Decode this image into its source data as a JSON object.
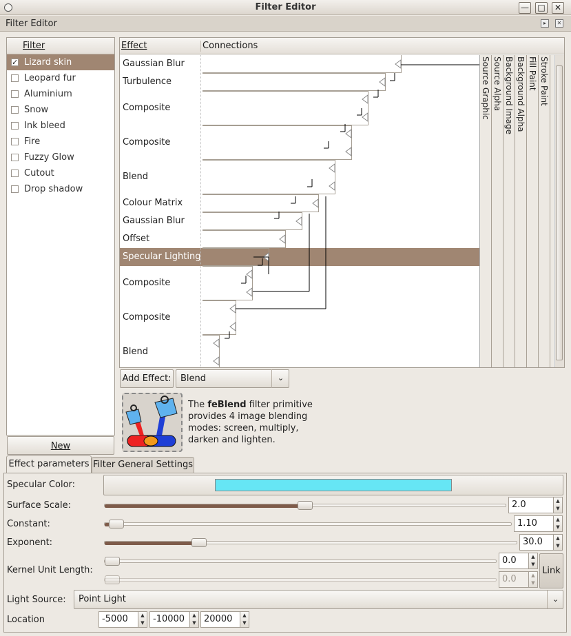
{
  "window": {
    "title": "Filter Editor"
  },
  "dock": {
    "title": "Filter Editor"
  },
  "filters": {
    "header": "Filter",
    "items": [
      {
        "label": "Lizard skin",
        "checked": true
      },
      {
        "label": "Leopard fur",
        "checked": false
      },
      {
        "label": "Aluminium",
        "checked": false
      },
      {
        "label": "Snow",
        "checked": false
      },
      {
        "label": "Ink bleed",
        "checked": false
      },
      {
        "label": "Fire",
        "checked": false
      },
      {
        "label": "Fuzzy Glow",
        "checked": false
      },
      {
        "label": "Cutout",
        "checked": false
      },
      {
        "label": "Drop shadow",
        "checked": false
      }
    ],
    "new_label": "New"
  },
  "effects": {
    "header_effect": "Effect",
    "header_connections": "Connections",
    "items": [
      {
        "label": "Gaussian Blur"
      },
      {
        "label": "Turbulence"
      },
      {
        "label": "Composite"
      },
      {
        "label": "Composite"
      },
      {
        "label": "Blend"
      },
      {
        "label": "Colour Matrix"
      },
      {
        "label": "Gaussian Blur"
      },
      {
        "label": "Offset"
      },
      {
        "label": "Specular Lighting",
        "selected": true
      },
      {
        "label": "Composite"
      },
      {
        "label": "Composite"
      },
      {
        "label": "Blend"
      }
    ],
    "sources": [
      "Source Graphic",
      "Source Alpha",
      "Background Image",
      "Background Alpha",
      "Fill Paint",
      "Stroke Paint"
    ]
  },
  "add_effect": {
    "button_label": "Add Effect:",
    "selected": "Blend"
  },
  "description": {
    "prefix": "The ",
    "primitive": "feBlend",
    "rest": " filter primitive provides 4 image blending modes: screen, multiply, darken and lighten."
  },
  "tabs": {
    "effect_params": "Effect parameters",
    "general": "Filter General Settings"
  },
  "params": {
    "specular_color_label": "Specular Color:",
    "specular_color": "#66e6f5",
    "surface_scale_label": "Surface Scale:",
    "surface_scale": "2.0",
    "surface_scale_fraction": 0.5,
    "constant_label": "Constant:",
    "constant": "1.10",
    "constant_fraction": 0.02,
    "exponent_label": "Exponent:",
    "exponent": "30.0",
    "exponent_fraction": 0.23,
    "kernel_label": "Kernel Unit Length:",
    "kernel_x": "0.0",
    "kernel_y": "0.0",
    "link_label": "Link",
    "light_source_label": "Light Source:",
    "light_source": "Point Light",
    "location_label": "Location",
    "location_x": "-5000",
    "location_y": "-10000",
    "location_z": "20000"
  },
  "colors": {
    "accent": "#a08672",
    "slider_fill": "#7e5b4a"
  }
}
